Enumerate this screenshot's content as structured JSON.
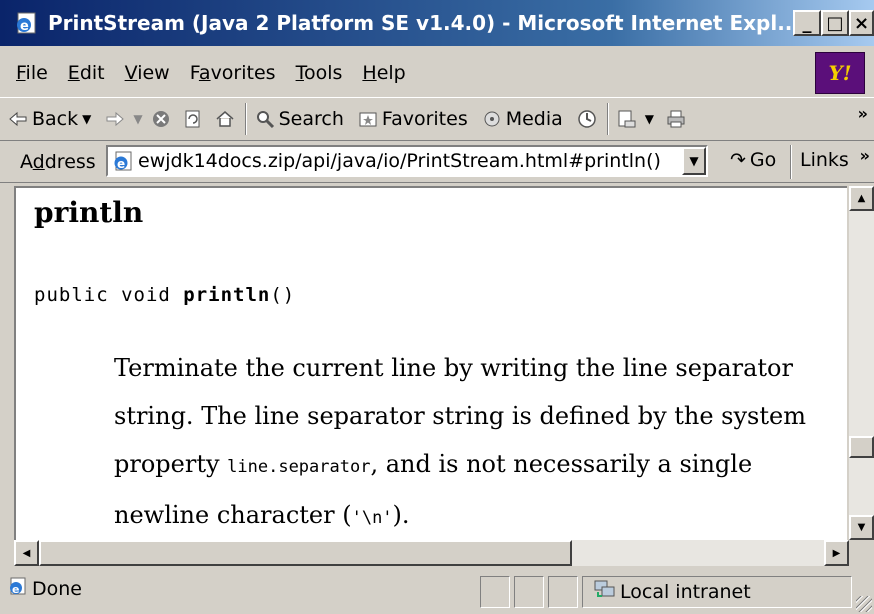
{
  "window": {
    "title": "PrintStream (Java 2 Platform SE v1.4.0) - Microsoft Internet Expl...",
    "min_glyph": "_",
    "max_glyph": "□",
    "close_glyph": "×"
  },
  "menu": {
    "items": [
      {
        "label_u": "F",
        "label_rest": "ile"
      },
      {
        "label_u": "E",
        "label_rest": "dit"
      },
      {
        "label_u": "V",
        "label_rest": "iew"
      },
      {
        "label_pre": "F",
        "label_u": "a",
        "label_rest": "vorites"
      },
      {
        "label_u": "T",
        "label_rest": "ools"
      },
      {
        "label_u": "H",
        "label_rest": "elp"
      }
    ],
    "yahoo_label": "Y!"
  },
  "toolbar": {
    "back_label": "Back",
    "search_label": "Search",
    "favorites_label": "Favorites",
    "media_label": "Media",
    "overflow": "»"
  },
  "address": {
    "label_pre": "A",
    "label_u": "d",
    "label_rest": "dress",
    "url": "ewjdk14docs.zip/api/java/io/PrintStream.html#println()",
    "go_label": "Go",
    "links_label": "Links",
    "overflow": "»"
  },
  "page": {
    "heading": "println",
    "signature_prefix": "public void ",
    "signature_method": "println",
    "signature_suffix": "()",
    "desc_part1": "Terminate the current line by writing the line separator string. The line separator string is defined by the system property ",
    "desc_code1": "line.separator",
    "desc_part2": ", and is not necessarily a single newline character (",
    "desc_code2": "'\\n'",
    "desc_part3": ")."
  },
  "status": {
    "text": "Done",
    "zone": "Local intranet"
  }
}
